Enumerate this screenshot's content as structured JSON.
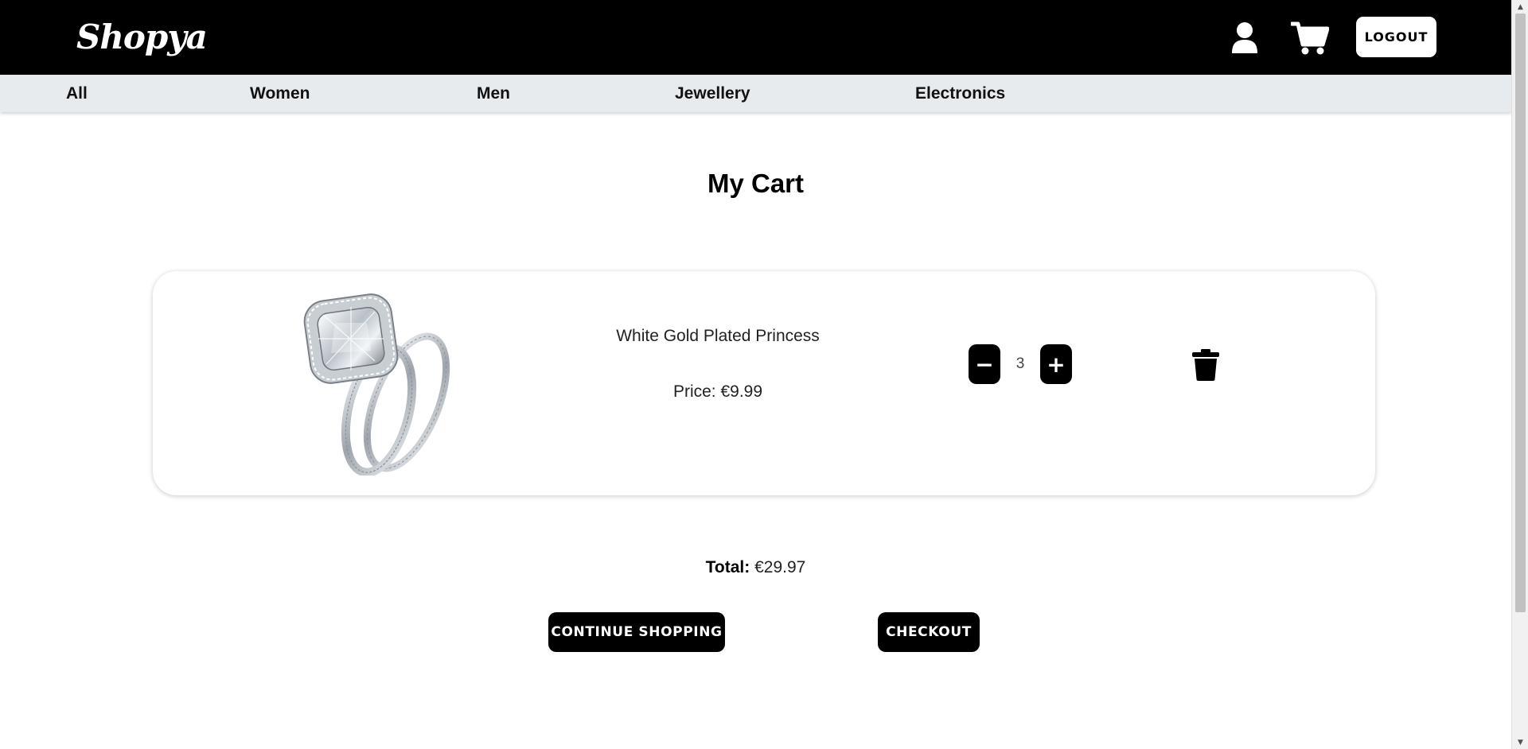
{
  "header": {
    "logo_text": "Shopya",
    "user_icon": "user-icon",
    "cart_icon": "shopping-cart-icon",
    "logout_label": "LOGOUT"
  },
  "categories": [
    "All",
    "Women",
    "Men",
    "Jewellery",
    "Electronics"
  ],
  "page_title": "My Cart",
  "cart_item": {
    "image_icon": "diamond-ring-image",
    "name": "White Gold Plated Princess",
    "price_text": "Price: €9.99",
    "quantity": "3",
    "minus_label": "−",
    "plus_label": "+",
    "delete_icon": "trash-icon"
  },
  "total": {
    "label": "Total:",
    "value": " €29.97"
  },
  "actions": {
    "continue_label": "CONTINUE SHOPPING",
    "checkout_label": "CHECKOUT"
  },
  "colors": {
    "header_bg": "#000000",
    "nav_bg": "#e8ebee",
    "button_bg": "#000000",
    "page_bg": "#ffffff"
  }
}
